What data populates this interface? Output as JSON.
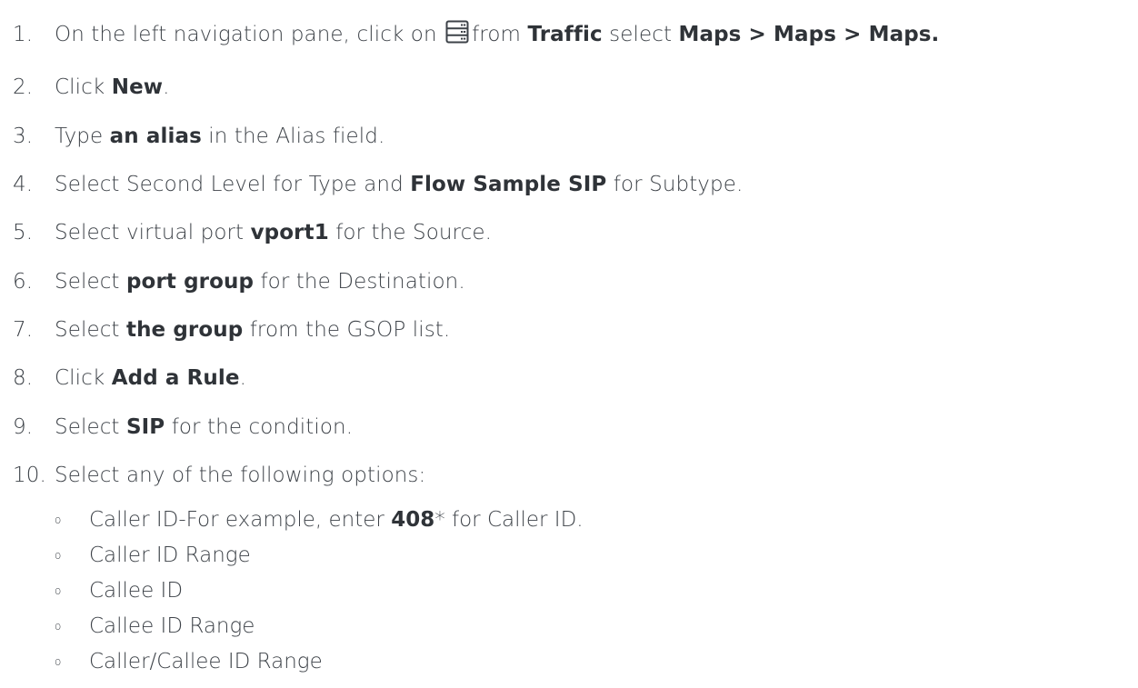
{
  "steps": [
    {
      "num": "1.",
      "parts": [
        "On the left navigation pane, click on",
        "from",
        "Traffic",
        "select",
        "Maps > Maps > Maps."
      ],
      "icon": "server-stack-icon"
    },
    {
      "num": "2.",
      "parts": [
        "Click",
        "New",
        "."
      ]
    },
    {
      "num": "3.",
      "parts": [
        "Type",
        "an alias",
        "in the Alias field."
      ]
    },
    {
      "num": "4.",
      "parts": [
        "Select Second Level for Type and",
        "Flow Sample SIP",
        "for Subtype."
      ]
    },
    {
      "num": "5.",
      "parts": [
        "Select virtual port",
        "vport1",
        "for the Source."
      ]
    },
    {
      "num": "6.",
      "parts": [
        "Select",
        "port group",
        "for the Destination."
      ]
    },
    {
      "num": "7.",
      "parts": [
        "Select",
        "the group",
        "from the GSOP list."
      ]
    },
    {
      "num": "8.",
      "parts": [
        "Click",
        "Add a Rule",
        "."
      ]
    },
    {
      "num": "9.",
      "parts": [
        "Select",
        "SIP",
        "for the condition."
      ]
    },
    {
      "num": "10.",
      "parts": [
        "Select any of the following options:"
      ]
    }
  ],
  "options": [
    {
      "bullet": "o",
      "parts": [
        "Caller ID-For example, enter",
        "408",
        "* for Caller ID."
      ]
    },
    {
      "bullet": "o",
      "parts": [
        "Caller ID Range"
      ]
    },
    {
      "bullet": "o",
      "parts": [
        "Callee ID"
      ]
    },
    {
      "bullet": "o",
      "parts": [
        "Callee ID Range"
      ]
    },
    {
      "bullet": "o",
      "parts": [
        "Caller/Callee ID Range"
      ]
    }
  ],
  "colors": {
    "text": "#3d4248",
    "bold": "#2f3338",
    "icon": "#3d4248"
  }
}
